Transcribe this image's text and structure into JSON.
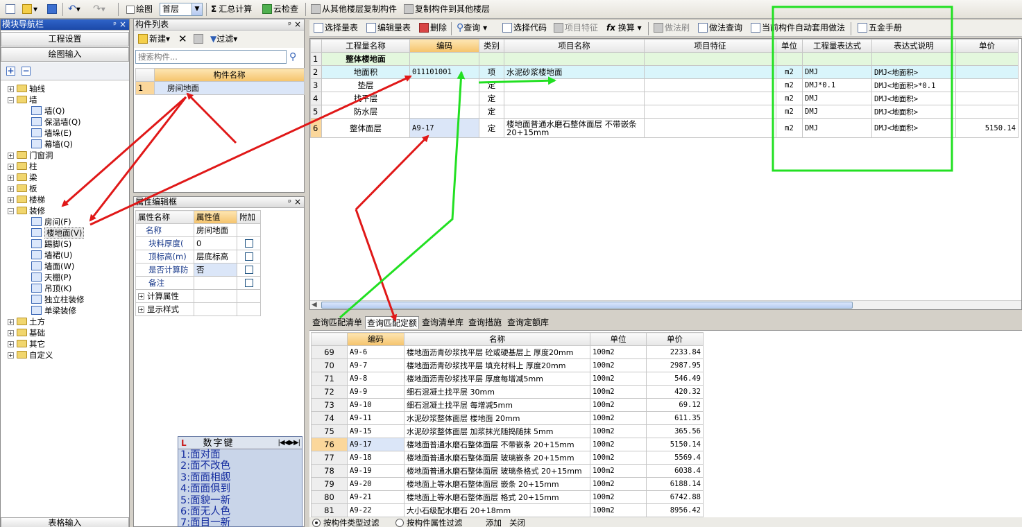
{
  "toolbar": {
    "draw_label": "绘图",
    "floor_value": "首层",
    "summary_label": "汇总计算",
    "cloud_check_label": "云检查",
    "copy_from_label": "从其他楼层复制构件",
    "copy_to_label": "复制构件到其他楼层"
  },
  "nav": {
    "title": "模块导航栏",
    "project_settings": "工程设置",
    "draw_input": "绘图输入",
    "table_input": "表格输入",
    "tree": [
      {
        "label": "轴线",
        "expanded": false
      },
      {
        "label": "墙",
        "expanded": true
      },
      {
        "label": "墙(Q)",
        "leaf": true
      },
      {
        "label": "保温墙(Q)",
        "leaf": true
      },
      {
        "label": "墙垛(E)",
        "leaf": true
      },
      {
        "label": "幕墙(Q)",
        "leaf": true
      },
      {
        "label": "门窗洞",
        "expanded": false
      },
      {
        "label": "柱",
        "expanded": false
      },
      {
        "label": "梁",
        "expanded": false
      },
      {
        "label": "板",
        "expanded": false
      },
      {
        "label": "楼梯",
        "expanded": false
      },
      {
        "label": "装修",
        "expanded": true
      },
      {
        "label": "房间(F)",
        "leaf": true
      },
      {
        "label": "楼地面(V)",
        "leaf": true,
        "selected": true
      },
      {
        "label": "踢脚(S)",
        "leaf": true
      },
      {
        "label": "墙裙(U)",
        "leaf": true
      },
      {
        "label": "墙面(W)",
        "leaf": true
      },
      {
        "label": "天棚(P)",
        "leaf": true
      },
      {
        "label": "吊顶(K)",
        "leaf": true
      },
      {
        "label": "独立柱装修",
        "leaf": true
      },
      {
        "label": "单梁装修",
        "leaf": true
      },
      {
        "label": "土方",
        "expanded": false
      },
      {
        "label": "基础",
        "expanded": false
      },
      {
        "label": "其它",
        "expanded": false
      },
      {
        "label": "自定义",
        "expanded": false
      }
    ]
  },
  "component_list": {
    "title": "构件列表",
    "new_label": "新建",
    "filter_label": "过滤",
    "search_placeholder": "搜索构件...",
    "col_header": "构件名称",
    "rows": [
      {
        "no": "1",
        "name": "房间地面"
      }
    ]
  },
  "prop_editor": {
    "title": "属性编辑框",
    "headers": [
      "属性名称",
      "属性值",
      "附加"
    ],
    "rows": [
      {
        "name": "名称",
        "value": "房间地面",
        "check": false
      },
      {
        "name": "块料厚度(",
        "value": "0",
        "check": true
      },
      {
        "name": "顶标高(m)",
        "value": "层底标高",
        "check": true
      },
      {
        "name": "是否计算防",
        "value": "否",
        "check": true
      },
      {
        "name": "备注",
        "value": "",
        "check": true
      }
    ],
    "groups": [
      "计算属性",
      "显示样式"
    ]
  },
  "numkey": {
    "title": "数字键",
    "lines": [
      "1:面对面",
      "2:面不改色",
      "3:面面相觑",
      "4:面面俱到",
      "5:面貌一新",
      "6:面无人色",
      "7:面目一新"
    ]
  },
  "right_toolbar": {
    "select_qty": "选择量表",
    "edit_qty": "编辑量表",
    "delete": "删除",
    "query": "查询",
    "select_code": "选择代码",
    "item_feature": "项目特征",
    "convert": "换算",
    "method_brush": "做法刷",
    "method_query": "做法查询",
    "auto_apply": "当前构件自动套用做法",
    "hardware_manual": "五金手册"
  },
  "main_table": {
    "headers": [
      "工程量名称",
      "编码",
      "类别",
      "项目名称",
      "项目特征",
      "单位",
      "工程量表达式",
      "表达式说明",
      "单价"
    ],
    "rows": [
      {
        "no": "1",
        "name": "整体楼地面",
        "code": "",
        "type": "",
        "item": "",
        "feature": "",
        "unit": "",
        "expr": "",
        "desc": "",
        "price": "",
        "group": true
      },
      {
        "no": "2",
        "name": "地面积",
        "code": "011101001",
        "type": "项",
        "item": "水泥砂浆楼地面",
        "feature": "",
        "unit": "m2",
        "expr": "DMJ",
        "desc": "DMJ<地面积>",
        "price": ""
      },
      {
        "no": "3",
        "name": "垫层",
        "code": "",
        "type": "定",
        "item": "",
        "feature": "",
        "unit": "m2",
        "expr": "DMJ*0.1",
        "desc": "DMJ<地面积>*0.1",
        "price": ""
      },
      {
        "no": "4",
        "name": "找平层",
        "code": "",
        "type": "定",
        "item": "",
        "feature": "",
        "unit": "m2",
        "expr": "DMJ",
        "desc": "DMJ<地面积>",
        "price": ""
      },
      {
        "no": "5",
        "name": "防水层",
        "code": "",
        "type": "定",
        "item": "",
        "feature": "",
        "unit": "m2",
        "expr": "DMJ",
        "desc": "DMJ<地面积>",
        "price": ""
      },
      {
        "no": "6",
        "name": "整体面层",
        "code": "A9-17",
        "type": "定",
        "item": "楼地面普通水磨石整体面层 不带嵌条 20+15mm",
        "feature": "",
        "unit": "m2",
        "expr": "DMJ",
        "desc": "DMJ<地面积>",
        "price": "5150.14"
      }
    ]
  },
  "bottom_tabs": [
    "查询匹配清单",
    "查询匹配定额",
    "查询清单库",
    "查询措施",
    "查询定额库"
  ],
  "quota_table": {
    "headers": [
      "编码",
      "名称",
      "单位",
      "单价"
    ],
    "rows": [
      {
        "no": "69",
        "code": "A9-6",
        "name": "楼地面沥青砂浆找平层 砼或硬基层上 厚度20mm",
        "unit": "100m2",
        "price": "2233.84"
      },
      {
        "no": "70",
        "code": "A9-7",
        "name": "楼地面沥青砂浆找平层 填充材料上 厚度20mm",
        "unit": "100m2",
        "price": "2987.95"
      },
      {
        "no": "71",
        "code": "A9-8",
        "name": "楼地面沥青砂浆找平层 厚度每增减5mm",
        "unit": "100m2",
        "price": "546.49"
      },
      {
        "no": "72",
        "code": "A9-9",
        "name": "细石混凝土找平层 30mm",
        "unit": "100m2",
        "price": "420.32"
      },
      {
        "no": "73",
        "code": "A9-10",
        "name": "细石混凝土找平层 每增减5mm",
        "unit": "100m2",
        "price": "69.12"
      },
      {
        "no": "74",
        "code": "A9-11",
        "name": "水泥砂浆整体面层 楼地面 20mm",
        "unit": "100m2",
        "price": "611.35"
      },
      {
        "no": "75",
        "code": "A9-15",
        "name": "水泥砂浆整体面层 加浆抹光随捣随抹 5mm",
        "unit": "100m2",
        "price": "365.56"
      },
      {
        "no": "76",
        "code": "A9-17",
        "name": "楼地面普通水磨石整体面层 不带嵌条 20+15mm",
        "unit": "100m2",
        "price": "5150.14",
        "selected": true
      },
      {
        "no": "77",
        "code": "A9-18",
        "name": "楼地面普通水磨石整体面层 玻璃嵌条 20+15mm",
        "unit": "100m2",
        "price": "5569.4"
      },
      {
        "no": "78",
        "code": "A9-19",
        "name": "楼地面普通水磨石整体面层 玻璃条格式 20+15mm",
        "unit": "100m2",
        "price": "6038.4"
      },
      {
        "no": "79",
        "code": "A9-20",
        "name": "楼地面上等水磨石整体面层 嵌条 20+15mm",
        "unit": "100m2",
        "price": "6188.14"
      },
      {
        "no": "80",
        "code": "A9-21",
        "name": "楼地面上等水磨石整体面层 格式 20+15mm",
        "unit": "100m2",
        "price": "6742.88"
      },
      {
        "no": "81",
        "code": "A9-22",
        "name": "大小石级配水磨石 20+18mm",
        "unit": "100m2",
        "price": "8956.42"
      }
    ]
  },
  "bottom_bar": {
    "radio_type": "按构件类型过滤",
    "radio_prop": "按构件属性过滤",
    "add": "添加",
    "close": "关闭"
  },
  "colors": {
    "annotation_red": "#e01818",
    "annotation_green": "#22e022",
    "header_highlight": "#f5c36b"
  }
}
